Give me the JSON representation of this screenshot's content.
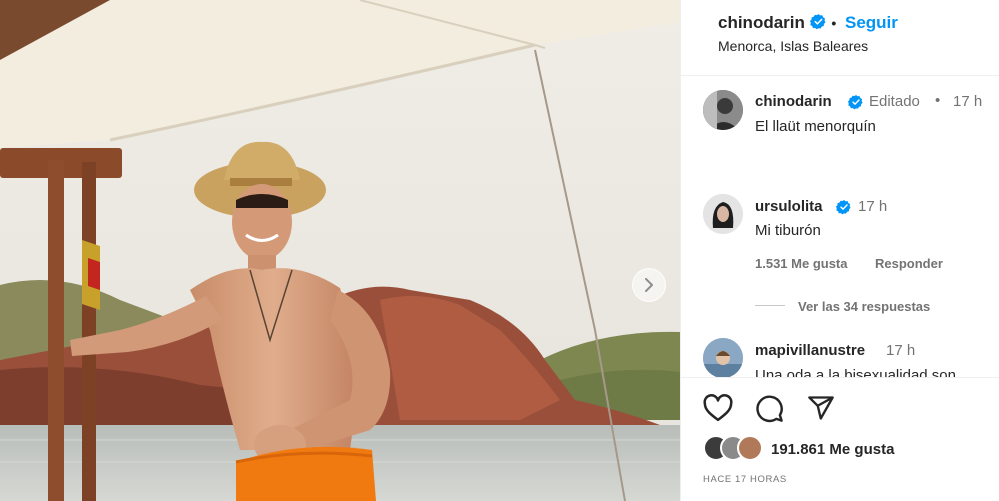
{
  "post": {
    "author": "chinodarin",
    "separator": "•",
    "follow_label": "Seguir",
    "location": "Menorca, Islas Baleares"
  },
  "comments": [
    {
      "user": "chinodarin",
      "edited": "Editado",
      "time": "17 h",
      "text": "El llaüt menorquín"
    },
    {
      "user": "ursulolita",
      "time": "17 h",
      "text": "Mi tiburón",
      "likes": "1.531 Me gusta",
      "reply_label": "Responder",
      "view_replies": "Ver las 34 respuestas"
    },
    {
      "user": "mapivillanustre",
      "time": "17 h",
      "text": "Una oda a la bisexualidad son..."
    }
  ],
  "actions": {
    "likes_count": "191.861",
    "likes_label": "Me gusta",
    "time_ago": "HACE 17 HORAS"
  },
  "colors": {
    "accent": "#0095f6",
    "verified": "#0095f6",
    "muted": "#737373"
  },
  "icons": [
    "verified-badge-icon",
    "chevron-right-icon",
    "heart-icon",
    "comment-icon",
    "share-icon"
  ]
}
